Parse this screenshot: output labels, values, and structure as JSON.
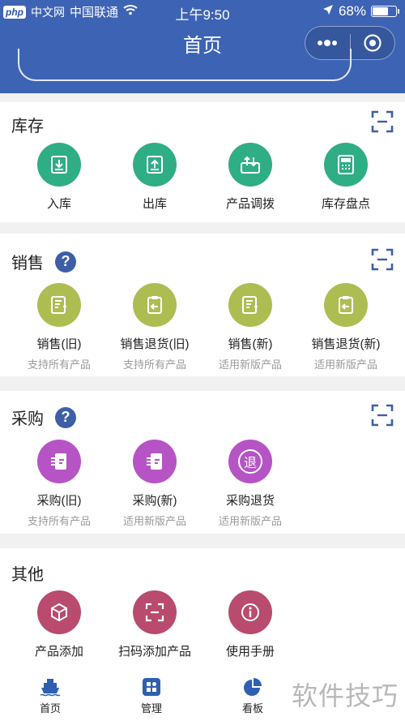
{
  "status_bar": {
    "brand": "php",
    "site": "中文网",
    "carrier": "中国联通",
    "time": "上午9:50",
    "battery": "68%",
    "battery_level": 0.68
  },
  "nav": {
    "title": "首页"
  },
  "sections": {
    "inventory": {
      "title": "库存",
      "items": [
        {
          "label": "入库",
          "icon": "stock-in-icon"
        },
        {
          "label": "出库",
          "icon": "stock-out-icon"
        },
        {
          "label": "产品调拨",
          "icon": "transfer-icon"
        },
        {
          "label": "库存盘点",
          "icon": "stocktake-icon"
        }
      ]
    },
    "sales": {
      "title": "销售",
      "items": [
        {
          "label": "销售(旧)",
          "sub": "支持所有产品",
          "icon": "sales-old-icon"
        },
        {
          "label": "销售退货(旧)",
          "sub": "支持所有产品",
          "icon": "sales-return-old-icon"
        },
        {
          "label": "销售(新)",
          "sub": "适用新版产品",
          "icon": "sales-new-icon"
        },
        {
          "label": "销售退货(新)",
          "sub": "适用新版产品",
          "icon": "sales-return-new-icon"
        }
      ]
    },
    "purchase": {
      "title": "采购",
      "items": [
        {
          "label": "采购(旧)",
          "sub": "支持所有产品",
          "icon": "purchase-old-icon"
        },
        {
          "label": "采购(新)",
          "sub": "适用新版产品",
          "icon": "purchase-new-icon"
        },
        {
          "label": "采购退货",
          "sub": "适用新版产品",
          "icon": "purchase-return-icon",
          "glyph": "退"
        }
      ]
    },
    "other": {
      "title": "其他",
      "items": [
        {
          "label": "产品添加",
          "icon": "product-add-icon"
        },
        {
          "label": "扫码添加产品",
          "icon": "scan-add-icon"
        },
        {
          "label": "使用手册",
          "icon": "manual-icon"
        }
      ]
    }
  },
  "tabbar": {
    "tabs": [
      {
        "label": "首页",
        "icon": "ship-icon",
        "active": true
      },
      {
        "label": "管理",
        "icon": "grid-icon"
      },
      {
        "label": "看板",
        "icon": "pie-chart-icon"
      }
    ]
  },
  "watermark": "软件技巧",
  "colors": {
    "header": "#3d63b4",
    "inventory": "#2fae86",
    "sales": "#aebd52",
    "purchase": "#b654c5",
    "other": "#b94b6e",
    "active_tab": "#2f5fb0"
  }
}
